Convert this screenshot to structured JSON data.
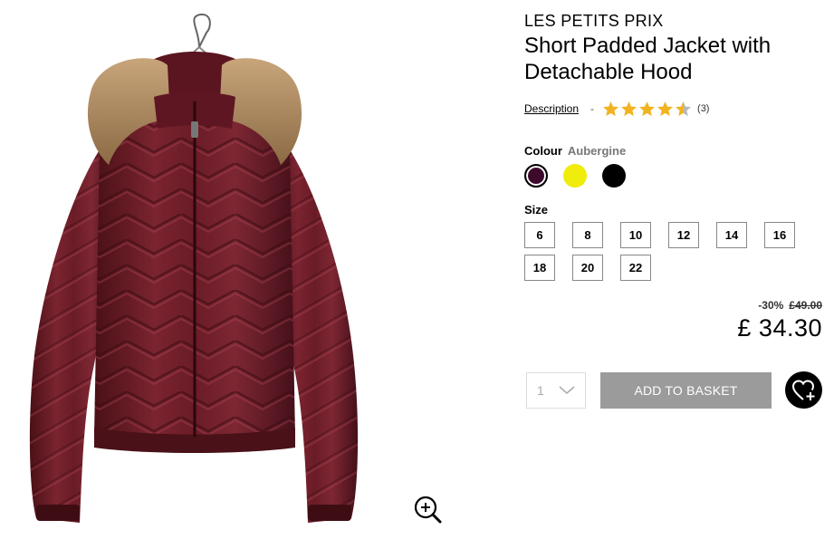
{
  "product": {
    "brand": "LES PETITS PRIX",
    "title": "Short Padded Jacket with Detachable Hood",
    "image_icon": "padded-jacket-image",
    "zoom_icon": "zoom-in-icon"
  },
  "reviews": {
    "description_link": "Description",
    "separator": "-",
    "rating": 4.5,
    "max_rating": 5,
    "count_label": "(3)",
    "star_color": "#f2b31f"
  },
  "colour": {
    "label": "Colour",
    "selected_name": "Aubergine",
    "swatches": [
      {
        "name": "Aubergine",
        "color": "#3d0a2c",
        "selected": true
      },
      {
        "name": "Yellow",
        "color": "#f0ec0b",
        "selected": false
      },
      {
        "name": "Black",
        "color": "#000000",
        "selected": false
      }
    ]
  },
  "size": {
    "label": "Size",
    "options": [
      "6",
      "8",
      "10",
      "12",
      "14",
      "16",
      "18",
      "20",
      "22"
    ]
  },
  "pricing": {
    "discount": "-30%",
    "old_price": "£49.00",
    "price": "£ 34.30"
  },
  "purchase": {
    "quantity": "1",
    "add_to_basket_label": "ADD TO BASKET",
    "basket_color": "#9b9b9b",
    "wishlist_icon": "heart-plus-icon"
  }
}
